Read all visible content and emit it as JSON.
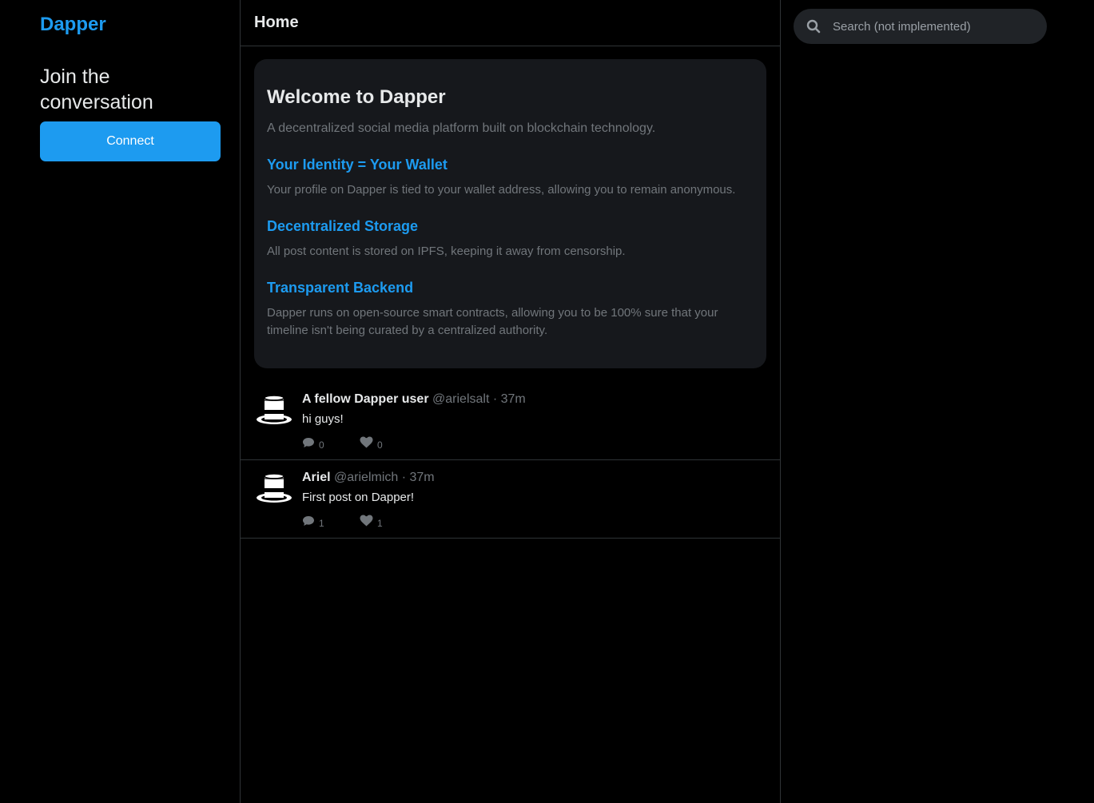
{
  "brand": "Dapper",
  "left": {
    "join_text": "Join the conversation",
    "connect_label": "Connect"
  },
  "header": {
    "title": "Home"
  },
  "welcome": {
    "title": "Welcome to Dapper",
    "intro": "A decentralized social media platform built on blockchain technology.",
    "features": [
      {
        "title": "Your Identity = Your Wallet",
        "text": "Your profile on Dapper is tied to your wallet address, allowing you to remain anonymous."
      },
      {
        "title": "Decentralized Storage",
        "text": "All post content is stored on IPFS, keeping it away from censorship."
      },
      {
        "title": "Transparent Backend",
        "text": "Dapper runs on open-source smart contracts, allowing you to be 100% sure that your timeline isn't being curated by a centralized authority."
      }
    ]
  },
  "posts": [
    {
      "name": "A fellow Dapper user",
      "meta": "@arielsalt · 37m",
      "text": "hi guys!",
      "comments": "0",
      "likes": "0",
      "avatar_icon": "top-hat-icon"
    },
    {
      "name": "Ariel",
      "meta": "@arielmich · 37m",
      "text": "First post on Dapper!",
      "comments": "1",
      "likes": "1",
      "avatar_icon": "top-hat-icon"
    }
  ],
  "search": {
    "placeholder": "Search (not implemented)"
  },
  "colors": {
    "accent": "#1d9bf0",
    "background": "#000000",
    "card": "#16181c",
    "muted": "#71767b"
  }
}
